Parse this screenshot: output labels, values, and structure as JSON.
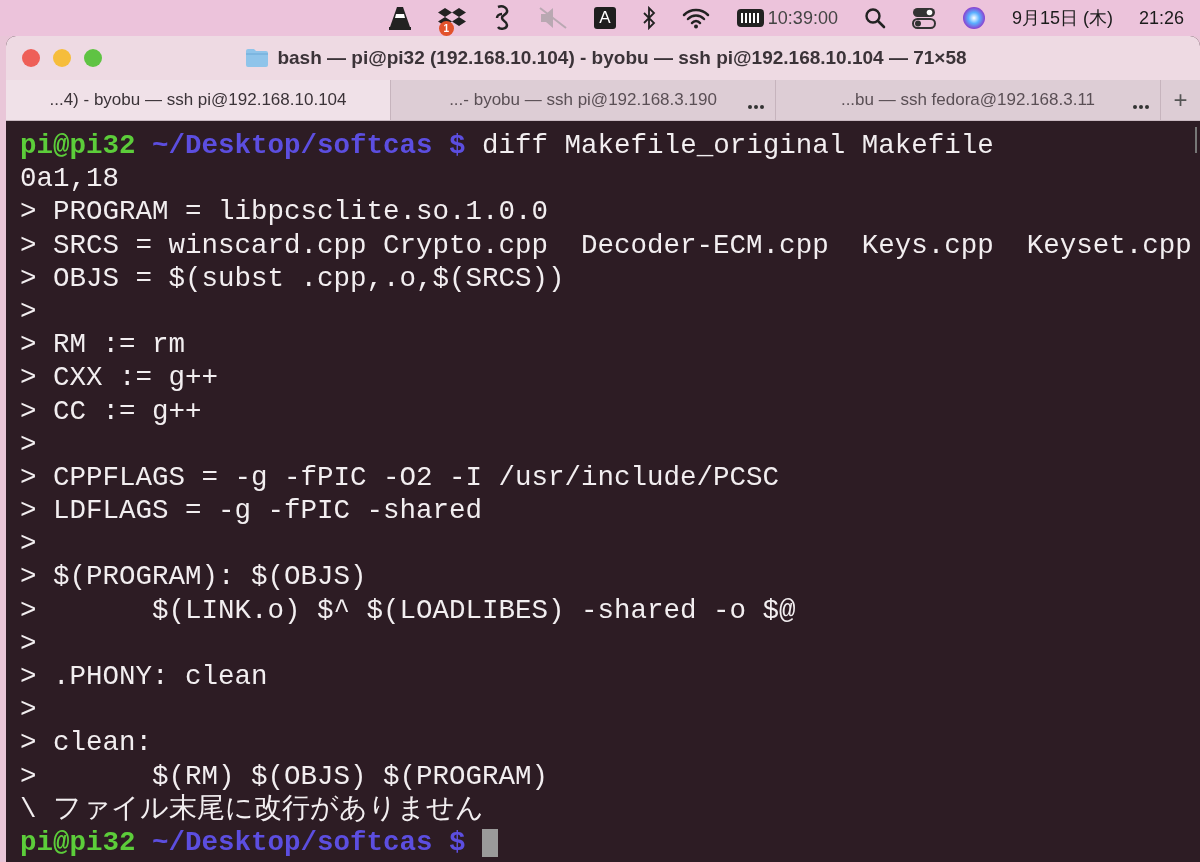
{
  "menu_bar": {
    "badge": "1",
    "input_source": "A",
    "clock": "10:39:00",
    "date": "9月15日 (木)",
    "time": "21:26"
  },
  "window": {
    "title": "bash — pi@pi32 (192.168.10.104) - byobu — ssh pi@192.168.10.104 — 71×58"
  },
  "tabs": [
    {
      "label": "...4) - byobu — ssh pi@192.168.10.104",
      "selected": true
    },
    {
      "label": "...- byobu — ssh pi@192.168.3.190",
      "selected": false
    },
    {
      "label": "...bu — ssh fedora@192.168.3.11",
      "selected": false
    }
  ],
  "new_tab": "+",
  "terminal": {
    "lines": [
      {
        "kind": "prompt",
        "user": "pi@pi32",
        "path": "~/Desktop/softcas",
        "symbol": "$",
        "command": "diff Makefile_original Makefile",
        "cursor": false
      },
      {
        "kind": "output",
        "text": "0a1,18"
      },
      {
        "kind": "output",
        "text": "> PROGRAM = libpcsclite.so.1.0.0"
      },
      {
        "kind": "output",
        "text": "> SRCS = winscard.cpp Crypto.cpp  Decoder-ECM.cpp  Keys.cpp  Keyset.cpp"
      },
      {
        "kind": "output",
        "text": "> OBJS = $(subst .cpp,.o,$(SRCS))"
      },
      {
        "kind": "output",
        "text": ">"
      },
      {
        "kind": "output",
        "text": "> RM := rm"
      },
      {
        "kind": "output",
        "text": "> CXX := g++"
      },
      {
        "kind": "output",
        "text": "> CC := g++"
      },
      {
        "kind": "output",
        "text": ">"
      },
      {
        "kind": "output",
        "text": "> CPPFLAGS = -g -fPIC -O2 -I /usr/include/PCSC"
      },
      {
        "kind": "output",
        "text": "> LDFLAGS = -g -fPIC -shared"
      },
      {
        "kind": "output",
        "text": ">"
      },
      {
        "kind": "output",
        "text": "> $(PROGRAM): $(OBJS)"
      },
      {
        "kind": "output",
        "text": ">       $(LINK.o) $^ $(LOADLIBES) -shared -o $@"
      },
      {
        "kind": "output",
        "text": ">"
      },
      {
        "kind": "output",
        "text": "> .PHONY: clean"
      },
      {
        "kind": "output",
        "text": ">"
      },
      {
        "kind": "output",
        "text": "> clean:"
      },
      {
        "kind": "output",
        "text": ">       $(RM) $(OBJS) $(PROGRAM)"
      },
      {
        "kind": "output",
        "text": "\\ ファイル末尾に改行がありません"
      },
      {
        "kind": "prompt",
        "user": "pi@pi32",
        "path": "~/Desktop/softcas",
        "symbol": "$",
        "cursor": true
      }
    ]
  }
}
